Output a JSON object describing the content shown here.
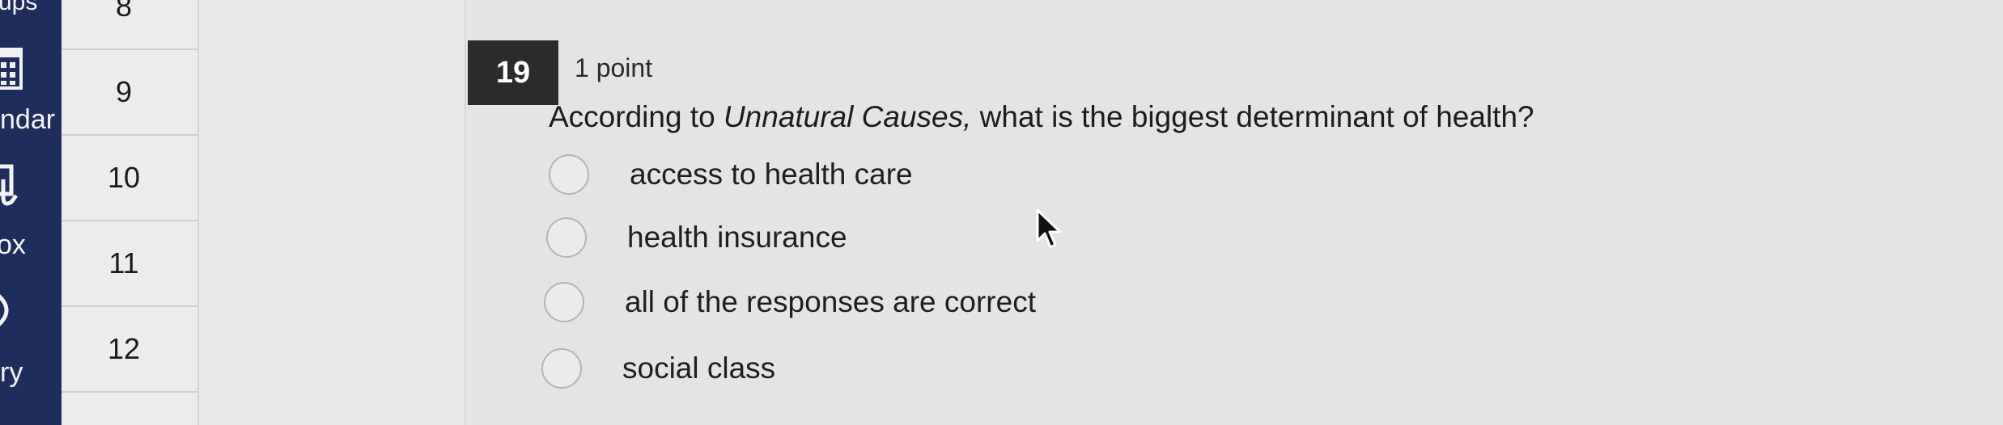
{
  "global_nav": {
    "items": [
      {
        "label": "ups",
        "icon": "groups-icon"
      },
      {
        "label": "ndar",
        "icon": "calendar-icon"
      },
      {
        "label": "ox",
        "icon": "inbox-icon"
      },
      {
        "label": "ry",
        "icon": "history-icon"
      }
    ]
  },
  "question_nav": {
    "items": [
      "8",
      "9",
      "10",
      "11",
      "12"
    ]
  },
  "question": {
    "number": "19",
    "points": "1 point",
    "text_before": "According to ",
    "text_italic": "Unnatural Causes,",
    "text_after": " what is the biggest determinant of health?",
    "options": [
      "access to health care",
      "health insurance",
      "all of the responses are correct",
      "social class"
    ]
  },
  "colors": {
    "nav_background": "#1e2d5b",
    "question_number_background": "#2b2b2b"
  }
}
